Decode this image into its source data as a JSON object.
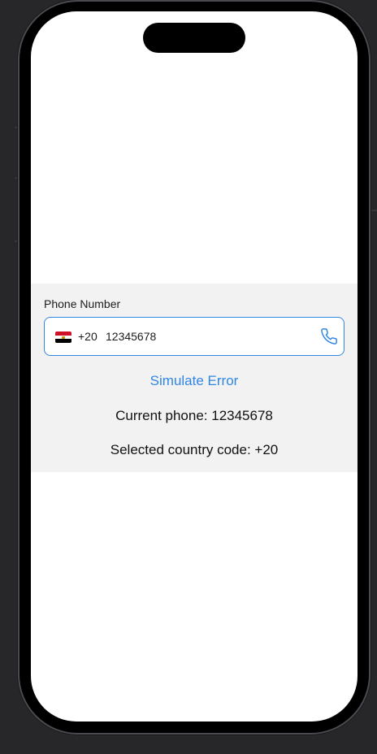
{
  "form": {
    "label": "Phone Number",
    "country_code": "+20",
    "phone_value": "12345678",
    "flag_icon": "egypt-flag-icon",
    "trailing_icon": "phone-icon",
    "accent_color": "#2f86e3"
  },
  "actions": {
    "simulate_error_label": "Simulate Error"
  },
  "status": {
    "current_phone": "Current phone: 12345678",
    "selected_country_code": "Selected country code: +20"
  }
}
